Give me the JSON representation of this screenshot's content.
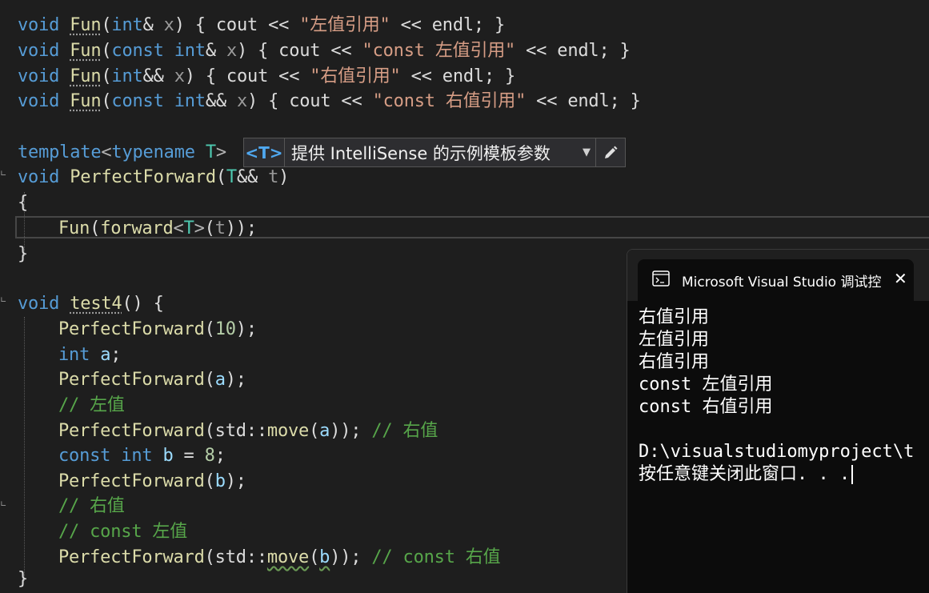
{
  "editor": {
    "lines": {
      "l1": {
        "kw": "void",
        "fn": "Fun",
        "p1": "(",
        "kw2": "int",
        "op": "&",
        "pm": "x",
        "p2": ") { cout << ",
        "str": "\"左值引用\"",
        "tail": " << endl; }"
      },
      "l2": {
        "kw": "void",
        "fn": "Fun",
        "p1": "(",
        "kw2": "const",
        "kw3": "int",
        "op": "&",
        "pm": "x",
        "p2": ") { cout << ",
        "str": "\"const 左值引用\"",
        "tail": " << endl; }"
      },
      "l3": {
        "kw": "void",
        "fn": "Fun",
        "p1": "(",
        "kw2": "int",
        "op": "&&",
        "pm": "x",
        "p2": ") { cout << ",
        "str": "\"右值引用\"",
        "tail": " << endl; }"
      },
      "l4": {
        "kw": "void",
        "fn": "Fun",
        "p1": "(",
        "kw2": "const",
        "kw3": "int",
        "op": "&&",
        "pm": "x",
        "p2": ") { cout << ",
        "str": "\"const 右值引用\"",
        "tail": " << endl; }"
      },
      "l6": {
        "kw": "template",
        "lt": "<",
        "kw2": "typename",
        "ty": "T",
        "gt": ">"
      },
      "l7": {
        "kw": "void",
        "fn": "PerfectForward",
        "p1": "(",
        "ty": "T",
        "op": "&&",
        "pm": "t",
        "p2": ")"
      },
      "l8": {
        "text": "{"
      },
      "l9": {
        "fn": "Fun",
        "p1": "(",
        "fn2": "forward",
        "lt": "<",
        "ty": "T",
        "gt": ">",
        "p2": "(",
        "pm": "t",
        "p3": "));"
      },
      "l10": {
        "text": "}"
      },
      "l12": {
        "kw": "void",
        "fn": "test4",
        "p1": "() {"
      },
      "l13": {
        "fn": "PerfectForward",
        "p1": "(",
        "num": "10",
        "p2": ");"
      },
      "l14": {
        "kw": "int",
        "id": "a",
        "p1": ";"
      },
      "l15": {
        "fn": "PerfectForward",
        "p1": "(",
        "id": "a",
        "p2": ");"
      },
      "l16": {
        "cm": "// 左值"
      },
      "l17": {
        "fn": "PerfectForward",
        "p1": "(std::",
        "fn2": "move",
        "p2": "(",
        "id": "a",
        "p3": ")); ",
        "cm": "// 右值"
      },
      "l18": {
        "kw": "const",
        "kw2": "int",
        "id": "b",
        "p1": " = ",
        "num": "8",
        "p2": ";"
      },
      "l19": {
        "fn": "PerfectForward",
        "p1": "(",
        "id": "b",
        "p2": ");"
      },
      "l20": {
        "cm": "// 右值"
      },
      "l21": {
        "cm": "// const 左值"
      },
      "l22": {
        "fn": "PerfectForward",
        "p1": "(std::",
        "fn2": "move",
        "p2": "(",
        "id": "b",
        "p3": ")); ",
        "cm": "// const 右值"
      },
      "l23": {
        "text": "}"
      }
    }
  },
  "template_bar": {
    "chip": "<T>",
    "label": "提供 IntelliSense 的示例模板参数"
  },
  "console": {
    "title": "Microsoft Visual Studio 调试控",
    "output": [
      "右值引用",
      "左值引用",
      "右值引用",
      "const 左值引用",
      "const 右值引用",
      "",
      "D:\\visualstudiomyproject\\t",
      "按任意键关闭此窗口. . ."
    ]
  },
  "colors": {
    "background": "#1e1e1e",
    "keyword": "#569cd6",
    "function": "#dcdcaa",
    "type": "#4ec9b0",
    "string": "#d69d85",
    "comment": "#57a64a",
    "number": "#b5cea8"
  },
  "icons": {
    "console_icon": "terminal-icon",
    "close_icon": "close-icon",
    "edit_icon": "pencil-icon",
    "dropdown_icon": "chevron-down-icon"
  }
}
